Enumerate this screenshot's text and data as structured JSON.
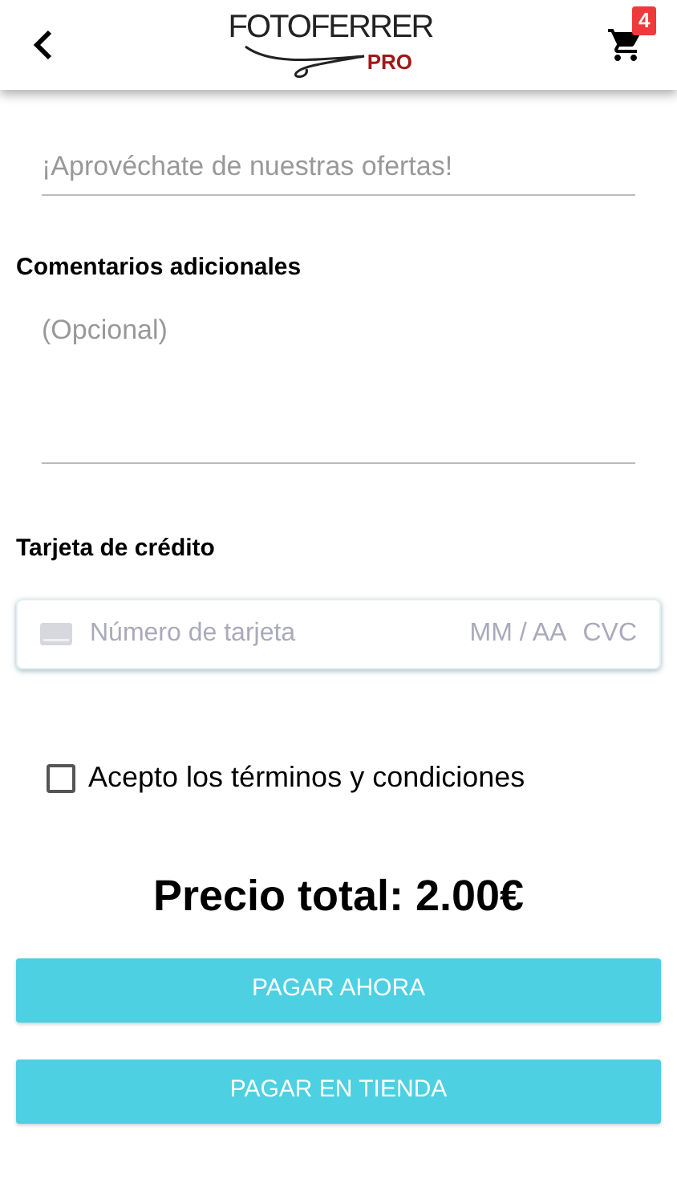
{
  "header": {
    "logo": {
      "name": "FOTOFERRER",
      "tag": "PRO"
    },
    "cart_count": "4"
  },
  "promo_field": {
    "placeholder": "¡Aprovéchate de nuestras ofertas!"
  },
  "comments": {
    "label": "Comentarios adicionales",
    "placeholder": "(Opcional)"
  },
  "card": {
    "label": "Tarjeta de crédito",
    "number_placeholder": "Número de tarjeta",
    "expiry_placeholder": "MM / AA",
    "cvc_placeholder": "CVC"
  },
  "terms": {
    "label": "Acepto los términos y condiciones",
    "checked": false
  },
  "total": "Precio total: 2.00€",
  "buttons": [
    {
      "label": "PAGAR AHORA"
    },
    {
      "label": "PAGAR EN TIENDA"
    }
  ]
}
